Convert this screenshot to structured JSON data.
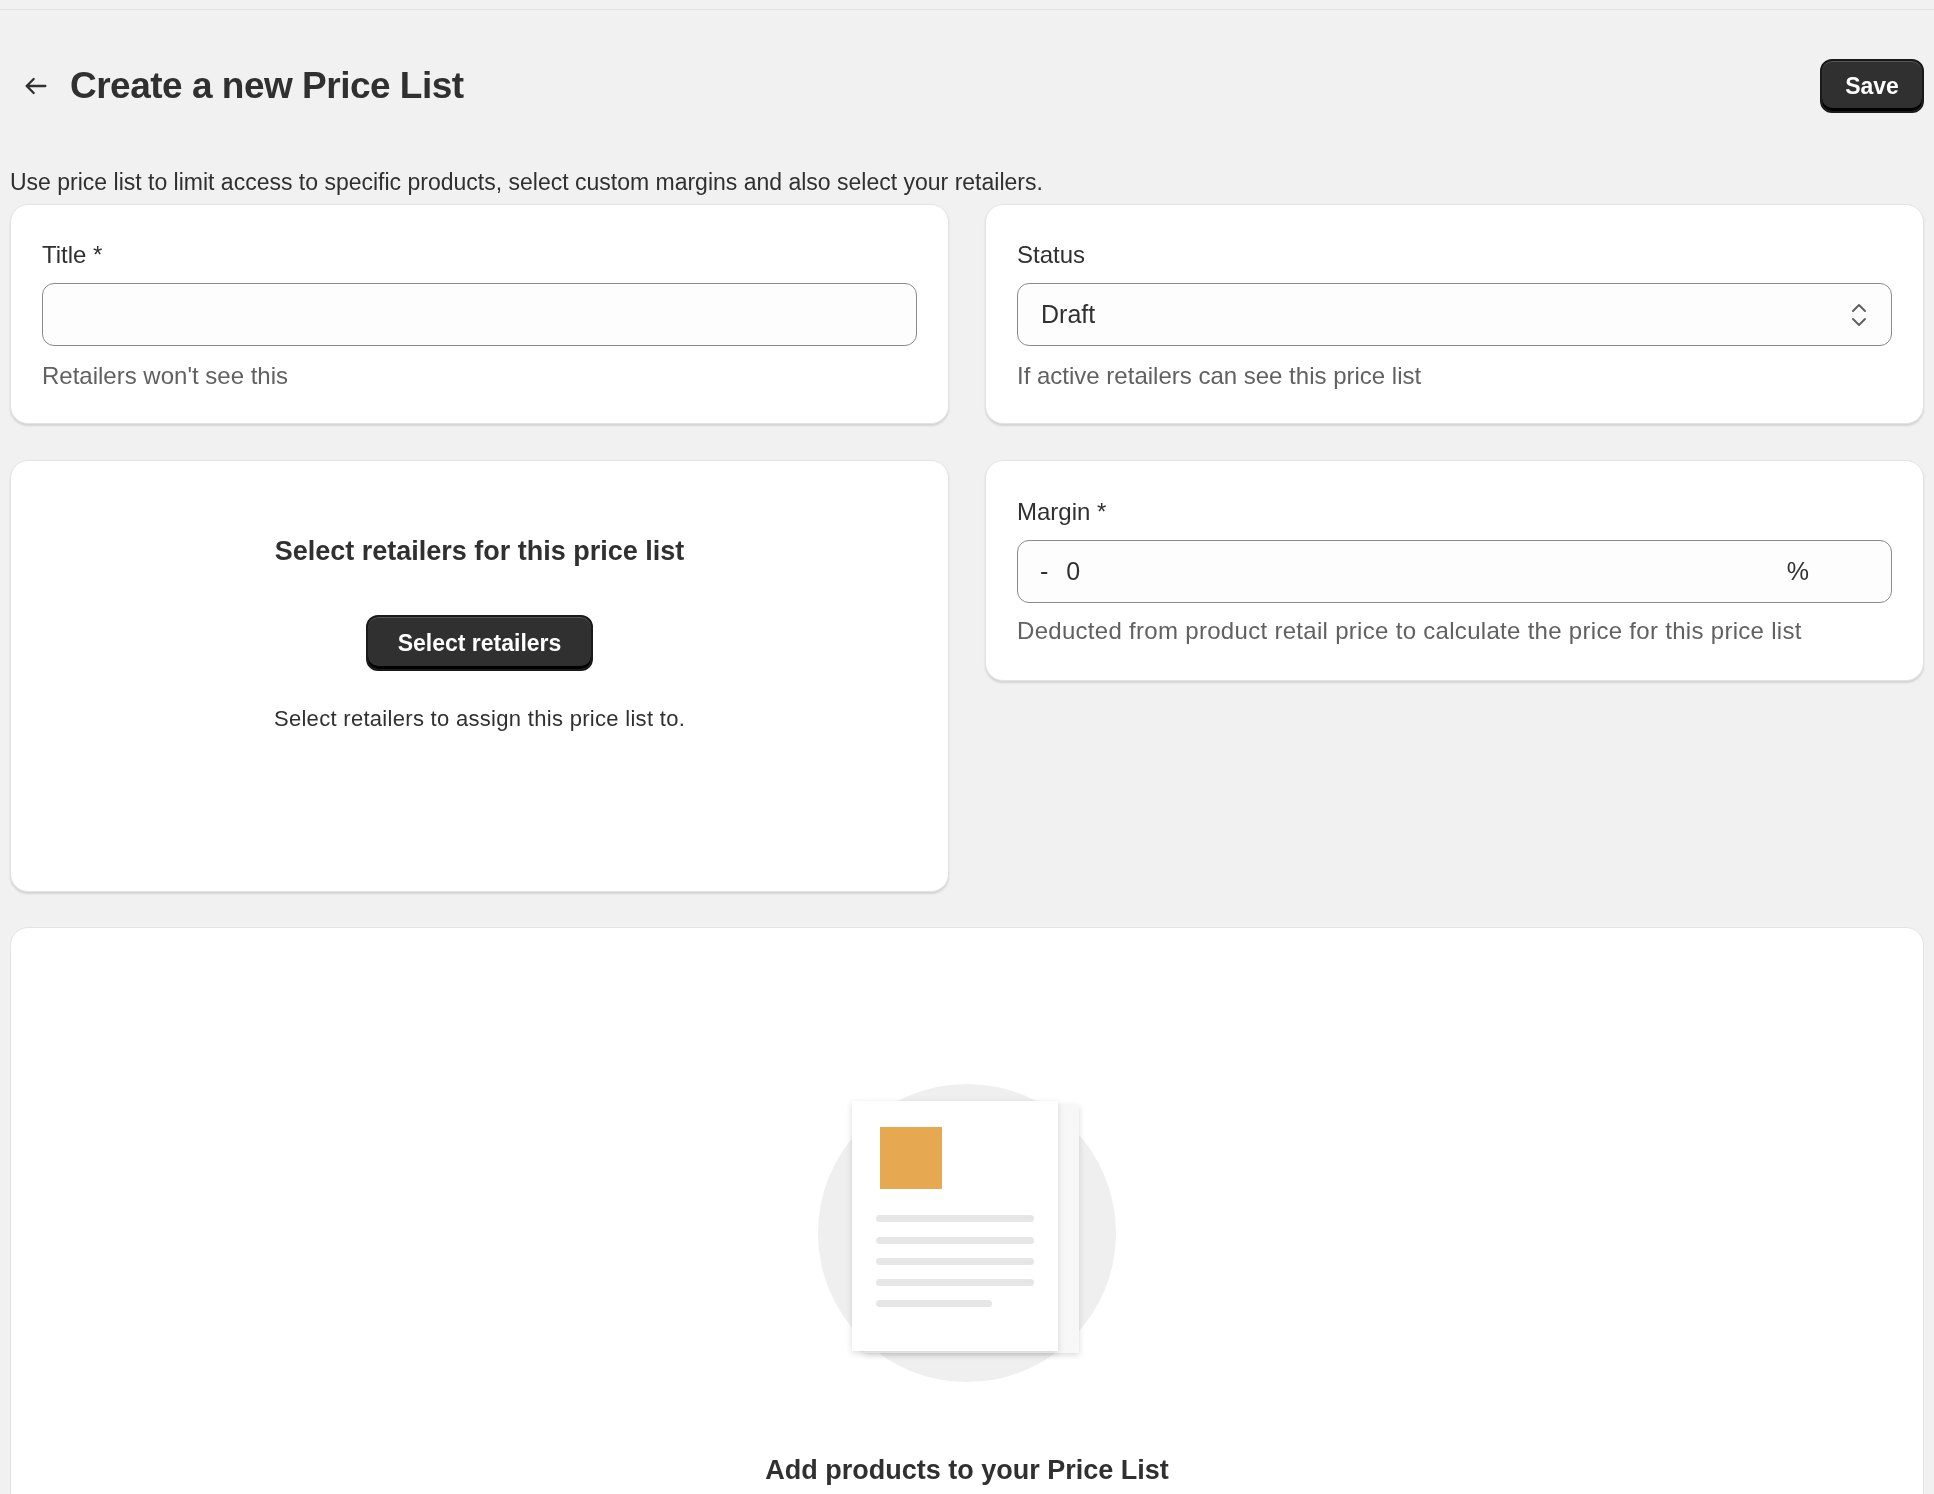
{
  "header": {
    "title": "Create a new Price List",
    "save_button": "Save"
  },
  "description": "Use price list to limit access to specific products, select custom margins and also select your retailers.",
  "title_card": {
    "label": "Title *",
    "helper": "Retailers won't see this"
  },
  "status_card": {
    "label": "Status",
    "value": "Draft",
    "helper": "If active retailers can see this price list"
  },
  "retailers_card": {
    "heading": "Select retailers for this price list",
    "button": "Select retailers",
    "helper": "Select retailers to assign this price list to."
  },
  "margin_card": {
    "label": "Margin *",
    "prefix": "-",
    "value": "0",
    "suffix": "%",
    "helper": "Deducted from product retail price to calculate the price for this price list"
  },
  "products_card": {
    "heading": "Add products to your Price List"
  }
}
